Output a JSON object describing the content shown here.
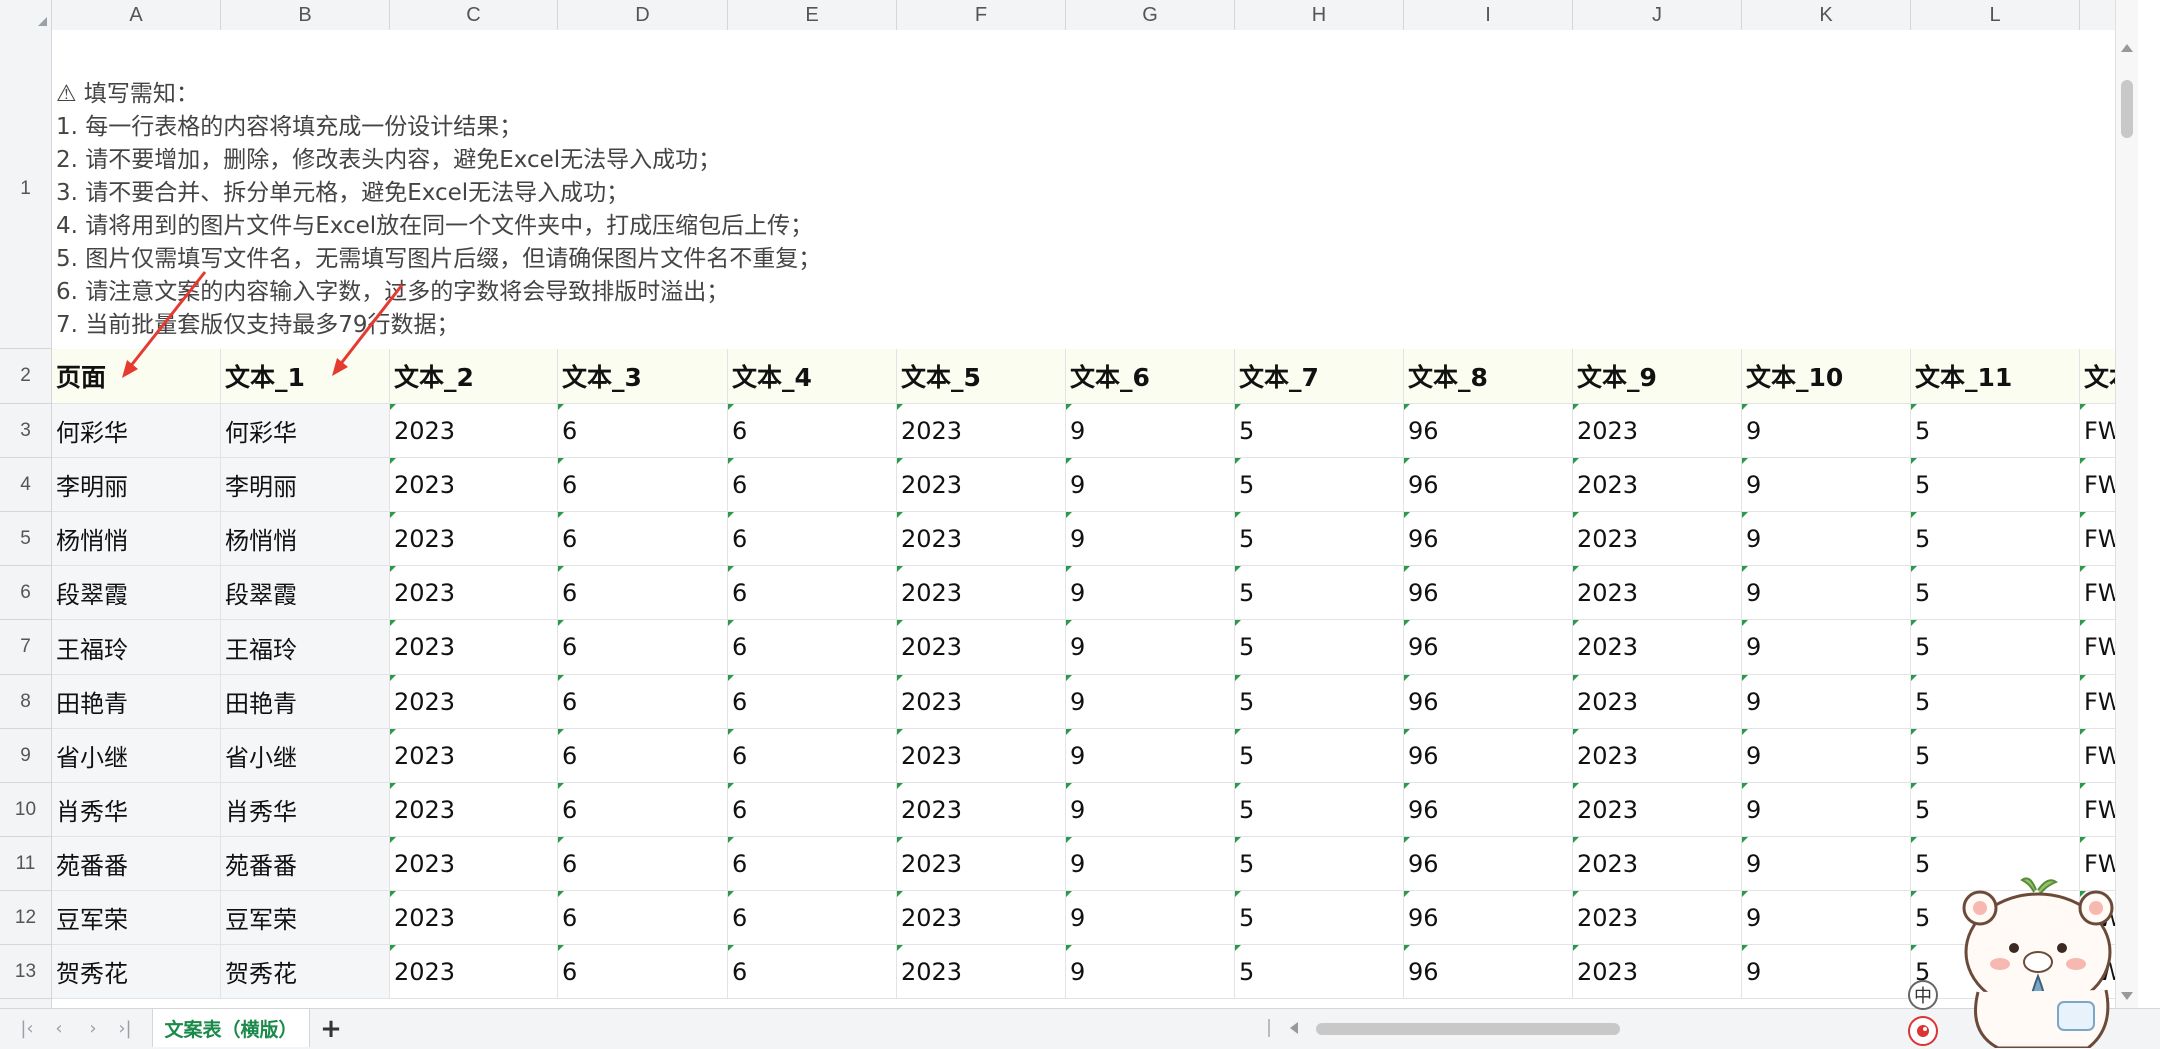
{
  "columns": [
    "A",
    "B",
    "C",
    "D",
    "E",
    "F",
    "G",
    "H",
    "I",
    "J",
    "K",
    "L"
  ],
  "row_numbers": [
    "1",
    "2",
    "3",
    "4",
    "5",
    "6",
    "7",
    "8",
    "9",
    "10",
    "11",
    "12",
    "13"
  ],
  "notice": [
    "⚠ 填写需知：",
    "1. 每一行表格的内容将填充成一份设计结果；",
    "2. 请不要增加，删除，修改表头内容，避免Excel无法导入成功；",
    "3. 请不要合并、拆分单元格，避免Excel无法导入成功；",
    "4. 请将用到的图片文件与Excel放在同一个文件夹中，打成压缩包后上传；",
    "5. 图片仅需填写文件名，无需填写图片后缀，但请确保图片文件名不重复；",
    "6. 请注意文案的内容输入字数，过多的字数将会导致排版时溢出；",
    "7. 当前批量套版仅支持最多79行数据；"
  ],
  "headers": [
    "页面",
    "文本_1",
    "文本_2",
    "文本_3",
    "文本_4",
    "文本_5",
    "文本_6",
    "文本_7",
    "文本_8",
    "文本_9",
    "文本_10",
    "文本_11",
    "文本_"
  ],
  "rows": [
    [
      "何彩华",
      "何彩华",
      "2023",
      "6",
      "6",
      "2023",
      "9",
      "5",
      "96",
      "2023",
      "9",
      "5",
      "FWZ"
    ],
    [
      "李明丽",
      "李明丽",
      "2023",
      "6",
      "6",
      "2023",
      "9",
      "5",
      "96",
      "2023",
      "9",
      "5",
      "FWZ"
    ],
    [
      "杨悄悄",
      "杨悄悄",
      "2023",
      "6",
      "6",
      "2023",
      "9",
      "5",
      "96",
      "2023",
      "9",
      "5",
      "FWZ"
    ],
    [
      "段翠霞",
      "段翠霞",
      "2023",
      "6",
      "6",
      "2023",
      "9",
      "5",
      "96",
      "2023",
      "9",
      "5",
      "FWZ"
    ],
    [
      "王福玲",
      "王福玲",
      "2023",
      "6",
      "6",
      "2023",
      "9",
      "5",
      "96",
      "2023",
      "9",
      "5",
      "FWZ"
    ],
    [
      "田艳青",
      "田艳青",
      "2023",
      "6",
      "6",
      "2023",
      "9",
      "5",
      "96",
      "2023",
      "9",
      "5",
      "FWZ"
    ],
    [
      "省小继",
      "省小继",
      "2023",
      "6",
      "6",
      "2023",
      "9",
      "5",
      "96",
      "2023",
      "9",
      "5",
      "FWZ"
    ],
    [
      "肖秀华",
      "肖秀华",
      "2023",
      "6",
      "6",
      "2023",
      "9",
      "5",
      "96",
      "2023",
      "9",
      "5",
      "FWZ"
    ],
    [
      "苑番番",
      "苑番番",
      "2023",
      "6",
      "6",
      "2023",
      "9",
      "5",
      "96",
      "2023",
      "9",
      "5",
      "FWZ"
    ],
    [
      "豆军荣",
      "豆军荣",
      "2023",
      "6",
      "6",
      "2023",
      "9",
      "5",
      "96",
      "2023",
      "9",
      "5",
      "FWZ"
    ],
    [
      "贺秀花",
      "贺秀花",
      "2023",
      "6",
      "6",
      "2023",
      "9",
      "5",
      "96",
      "2023",
      "9",
      "5",
      "FWZ"
    ]
  ],
  "sheet_tab": "文案表（横版）",
  "add_sheet": "+",
  "ime_label": "中",
  "nav": [
    "|‹",
    "‹",
    "›",
    "›|"
  ],
  "colors": {
    "header_fill": "#fbfdf0",
    "tab_text": "#1a8a4a",
    "arrow": "#e53a2f"
  }
}
